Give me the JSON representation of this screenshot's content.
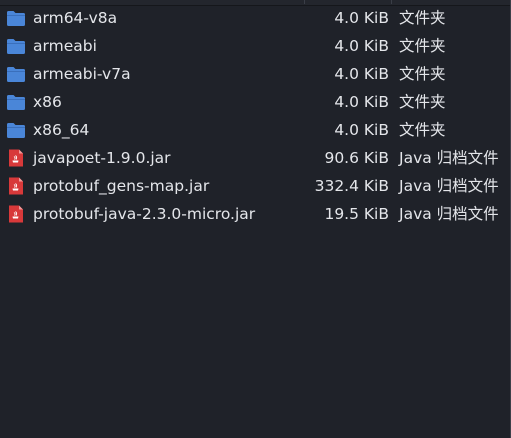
{
  "colors": {
    "background": "#1f2229",
    "text": "#e4e6ea",
    "folder_icon": "#4a86d8",
    "archive_icon": "#d8393a"
  },
  "files": [
    {
      "name": "arm64-v8a",
      "size": "4.0 KiB",
      "type": "文件夹",
      "icon": "folder-icon"
    },
    {
      "name": "armeabi",
      "size": "4.0 KiB",
      "type": "文件夹",
      "icon": "folder-icon"
    },
    {
      "name": "armeabi-v7a",
      "size": "4.0 KiB",
      "type": "文件夹",
      "icon": "folder-icon"
    },
    {
      "name": "x86",
      "size": "4.0 KiB",
      "type": "文件夹",
      "icon": "folder-icon"
    },
    {
      "name": "x86_64",
      "size": "4.0 KiB",
      "type": "文件夹",
      "icon": "folder-icon"
    },
    {
      "name": "javapoet-1.9.0.jar",
      "size": "90.6 KiB",
      "type": "Java 归档文件",
      "icon": "java-archive-icon"
    },
    {
      "name": "protobuf_gens-map.jar",
      "size": "332.4 KiB",
      "type": "Java 归档文件",
      "icon": "java-archive-icon"
    },
    {
      "name": "protobuf-java-2.3.0-micro.jar",
      "size": "19.5 KiB",
      "type": "Java 归档文件",
      "icon": "java-archive-icon"
    }
  ]
}
